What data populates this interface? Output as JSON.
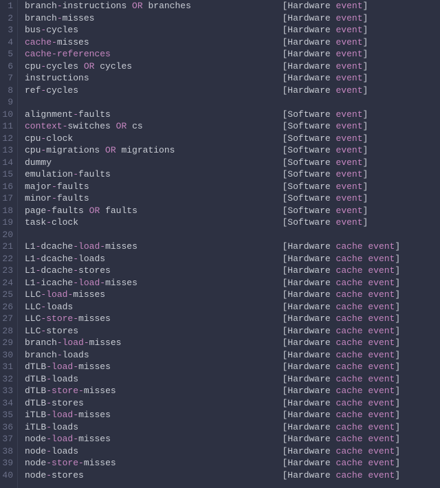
{
  "colors": {
    "background": "#2d3142",
    "foreground": "#c8ccd4",
    "gutter": "#6b7089",
    "gutterBorder": "#3a3f52",
    "keyword": "#c586c0",
    "highlight": "#c586c0"
  },
  "columnStart": 48,
  "lines": [
    {
      "num": 1,
      "left": [
        [
          "plain",
          "branch"
        ],
        [
          "kw",
          "-"
        ],
        [
          "plain",
          "instructions"
        ],
        [
          "kw",
          " OR "
        ],
        [
          "plain",
          "branches"
        ]
      ],
      "right": [
        [
          "plain",
          "[Hardware "
        ],
        [
          "hl",
          "event"
        ],
        [
          "plain",
          "]"
        ]
      ]
    },
    {
      "num": 2,
      "left": [
        [
          "plain",
          "branch"
        ],
        [
          "kw",
          "-"
        ],
        [
          "plain",
          "misses"
        ]
      ],
      "right": [
        [
          "plain",
          "[Hardware "
        ],
        [
          "hl",
          "event"
        ],
        [
          "plain",
          "]"
        ]
      ]
    },
    {
      "num": 3,
      "left": [
        [
          "plain",
          "bus"
        ],
        [
          "kw",
          "-"
        ],
        [
          "plain",
          "cycles"
        ]
      ],
      "right": [
        [
          "plain",
          "[Hardware "
        ],
        [
          "hl",
          "event"
        ],
        [
          "plain",
          "]"
        ]
      ]
    },
    {
      "num": 4,
      "left": [
        [
          "hl",
          "cache"
        ],
        [
          "kw",
          "-"
        ],
        [
          "plain",
          "misses"
        ]
      ],
      "right": [
        [
          "plain",
          "[Hardware "
        ],
        [
          "hl",
          "event"
        ],
        [
          "plain",
          "]"
        ]
      ]
    },
    {
      "num": 5,
      "left": [
        [
          "hl",
          "cache"
        ],
        [
          "kw",
          "-"
        ],
        [
          "hl",
          "references"
        ]
      ],
      "right": [
        [
          "plain",
          "[Hardware "
        ],
        [
          "hl",
          "event"
        ],
        [
          "plain",
          "]"
        ]
      ]
    },
    {
      "num": 6,
      "left": [
        [
          "plain",
          "cpu"
        ],
        [
          "kw",
          "-"
        ],
        [
          "plain",
          "cycles"
        ],
        [
          "kw",
          " OR "
        ],
        [
          "plain",
          "cycles"
        ]
      ],
      "right": [
        [
          "plain",
          "[Hardware "
        ],
        [
          "hl",
          "event"
        ],
        [
          "plain",
          "]"
        ]
      ]
    },
    {
      "num": 7,
      "left": [
        [
          "plain",
          "instructions"
        ]
      ],
      "right": [
        [
          "plain",
          "[Hardware "
        ],
        [
          "hl",
          "event"
        ],
        [
          "plain",
          "]"
        ]
      ]
    },
    {
      "num": 8,
      "left": [
        [
          "plain",
          "ref"
        ],
        [
          "kw",
          "-"
        ],
        [
          "plain",
          "cycles"
        ]
      ],
      "right": [
        [
          "plain",
          "[Hardware "
        ],
        [
          "hl",
          "event"
        ],
        [
          "plain",
          "]"
        ]
      ]
    },
    {
      "num": 9,
      "left": [],
      "right": []
    },
    {
      "num": 10,
      "left": [
        [
          "plain",
          "alignment"
        ],
        [
          "kw",
          "-"
        ],
        [
          "plain",
          "faults"
        ]
      ],
      "right": [
        [
          "plain",
          "[Software "
        ],
        [
          "hl",
          "event"
        ],
        [
          "plain",
          "]"
        ]
      ]
    },
    {
      "num": 11,
      "left": [
        [
          "hl",
          "context"
        ],
        [
          "kw",
          "-"
        ],
        [
          "plain",
          "switches"
        ],
        [
          "kw",
          " OR "
        ],
        [
          "plain",
          "cs"
        ]
      ],
      "right": [
        [
          "plain",
          "[Software "
        ],
        [
          "hl",
          "event"
        ],
        [
          "plain",
          "]"
        ]
      ]
    },
    {
      "num": 12,
      "left": [
        [
          "plain",
          "cpu"
        ],
        [
          "kw",
          "-"
        ],
        [
          "plain",
          "clock"
        ]
      ],
      "right": [
        [
          "plain",
          "[Software "
        ],
        [
          "hl",
          "event"
        ],
        [
          "plain",
          "]"
        ]
      ]
    },
    {
      "num": 13,
      "left": [
        [
          "plain",
          "cpu"
        ],
        [
          "kw",
          "-"
        ],
        [
          "plain",
          "migrations"
        ],
        [
          "kw",
          " OR "
        ],
        [
          "plain",
          "migrations"
        ]
      ],
      "right": [
        [
          "plain",
          "[Software "
        ],
        [
          "hl",
          "event"
        ],
        [
          "plain",
          "]"
        ]
      ]
    },
    {
      "num": 14,
      "left": [
        [
          "plain",
          "dummy"
        ]
      ],
      "right": [
        [
          "plain",
          "[Software "
        ],
        [
          "hl",
          "event"
        ],
        [
          "plain",
          "]"
        ]
      ]
    },
    {
      "num": 15,
      "left": [
        [
          "plain",
          "emulation"
        ],
        [
          "kw",
          "-"
        ],
        [
          "plain",
          "faults"
        ]
      ],
      "right": [
        [
          "plain",
          "[Software "
        ],
        [
          "hl",
          "event"
        ],
        [
          "plain",
          "]"
        ]
      ]
    },
    {
      "num": 16,
      "left": [
        [
          "plain",
          "major"
        ],
        [
          "kw",
          "-"
        ],
        [
          "plain",
          "faults"
        ]
      ],
      "right": [
        [
          "plain",
          "[Software "
        ],
        [
          "hl",
          "event"
        ],
        [
          "plain",
          "]"
        ]
      ]
    },
    {
      "num": 17,
      "left": [
        [
          "plain",
          "minor"
        ],
        [
          "kw",
          "-"
        ],
        [
          "plain",
          "faults"
        ]
      ],
      "right": [
        [
          "plain",
          "[Software "
        ],
        [
          "hl",
          "event"
        ],
        [
          "plain",
          "]"
        ]
      ]
    },
    {
      "num": 18,
      "left": [
        [
          "plain",
          "page"
        ],
        [
          "kw",
          "-"
        ],
        [
          "plain",
          "faults"
        ],
        [
          "kw",
          " OR "
        ],
        [
          "plain",
          "faults"
        ]
      ],
      "right": [
        [
          "plain",
          "[Software "
        ],
        [
          "hl",
          "event"
        ],
        [
          "plain",
          "]"
        ]
      ]
    },
    {
      "num": 19,
      "left": [
        [
          "plain",
          "task"
        ],
        [
          "kw",
          "-"
        ],
        [
          "plain",
          "clock"
        ]
      ],
      "right": [
        [
          "plain",
          "[Software "
        ],
        [
          "hl",
          "event"
        ],
        [
          "plain",
          "]"
        ]
      ]
    },
    {
      "num": 20,
      "left": [],
      "right": []
    },
    {
      "num": 21,
      "left": [
        [
          "plain",
          "L1"
        ],
        [
          "kw",
          "-"
        ],
        [
          "plain",
          "dcache"
        ],
        [
          "kw",
          "-"
        ],
        [
          "hl",
          "load"
        ],
        [
          "kw",
          "-"
        ],
        [
          "plain",
          "misses"
        ]
      ],
      "right": [
        [
          "plain",
          "[Hardware "
        ],
        [
          "hl",
          "cache event"
        ],
        [
          "plain",
          "]"
        ]
      ]
    },
    {
      "num": 22,
      "left": [
        [
          "plain",
          "L1"
        ],
        [
          "kw",
          "-"
        ],
        [
          "plain",
          "dcache"
        ],
        [
          "kw",
          "-"
        ],
        [
          "plain",
          "loads"
        ]
      ],
      "right": [
        [
          "plain",
          "[Hardware "
        ],
        [
          "hl",
          "cache event"
        ],
        [
          "plain",
          "]"
        ]
      ]
    },
    {
      "num": 23,
      "left": [
        [
          "plain",
          "L1"
        ],
        [
          "kw",
          "-"
        ],
        [
          "plain",
          "dcache"
        ],
        [
          "kw",
          "-"
        ],
        [
          "plain",
          "stores"
        ]
      ],
      "right": [
        [
          "plain",
          "[Hardware "
        ],
        [
          "hl",
          "cache event"
        ],
        [
          "plain",
          "]"
        ]
      ]
    },
    {
      "num": 24,
      "left": [
        [
          "plain",
          "L1"
        ],
        [
          "kw",
          "-"
        ],
        [
          "plain",
          "icache"
        ],
        [
          "kw",
          "-"
        ],
        [
          "hl",
          "load"
        ],
        [
          "kw",
          "-"
        ],
        [
          "plain",
          "misses"
        ]
      ],
      "right": [
        [
          "plain",
          "[Hardware "
        ],
        [
          "hl",
          "cache event"
        ],
        [
          "plain",
          "]"
        ]
      ]
    },
    {
      "num": 25,
      "left": [
        [
          "plain",
          "LLC"
        ],
        [
          "kw",
          "-"
        ],
        [
          "hl",
          "load"
        ],
        [
          "kw",
          "-"
        ],
        [
          "plain",
          "misses"
        ]
      ],
      "right": [
        [
          "plain",
          "[Hardware "
        ],
        [
          "hl",
          "cache event"
        ],
        [
          "plain",
          "]"
        ]
      ]
    },
    {
      "num": 26,
      "left": [
        [
          "plain",
          "LLC"
        ],
        [
          "kw",
          "-"
        ],
        [
          "plain",
          "loads"
        ]
      ],
      "right": [
        [
          "plain",
          "[Hardware "
        ],
        [
          "hl",
          "cache event"
        ],
        [
          "plain",
          "]"
        ]
      ]
    },
    {
      "num": 27,
      "left": [
        [
          "plain",
          "LLC"
        ],
        [
          "kw",
          "-"
        ],
        [
          "hl",
          "store"
        ],
        [
          "kw",
          "-"
        ],
        [
          "plain",
          "misses"
        ]
      ],
      "right": [
        [
          "plain",
          "[Hardware "
        ],
        [
          "hl",
          "cache event"
        ],
        [
          "plain",
          "]"
        ]
      ]
    },
    {
      "num": 28,
      "left": [
        [
          "plain",
          "LLC"
        ],
        [
          "kw",
          "-"
        ],
        [
          "plain",
          "stores"
        ]
      ],
      "right": [
        [
          "plain",
          "[Hardware "
        ],
        [
          "hl",
          "cache event"
        ],
        [
          "plain",
          "]"
        ]
      ]
    },
    {
      "num": 29,
      "left": [
        [
          "plain",
          "branch"
        ],
        [
          "kw",
          "-"
        ],
        [
          "hl",
          "load"
        ],
        [
          "kw",
          "-"
        ],
        [
          "plain",
          "misses"
        ]
      ],
      "right": [
        [
          "plain",
          "[Hardware "
        ],
        [
          "hl",
          "cache event"
        ],
        [
          "plain",
          "]"
        ]
      ]
    },
    {
      "num": 30,
      "left": [
        [
          "plain",
          "branch"
        ],
        [
          "kw",
          "-"
        ],
        [
          "plain",
          "loads"
        ]
      ],
      "right": [
        [
          "plain",
          "[Hardware "
        ],
        [
          "hl",
          "cache event"
        ],
        [
          "plain",
          "]"
        ]
      ]
    },
    {
      "num": 31,
      "left": [
        [
          "plain",
          "dTLB"
        ],
        [
          "kw",
          "-"
        ],
        [
          "hl",
          "load"
        ],
        [
          "kw",
          "-"
        ],
        [
          "plain",
          "misses"
        ]
      ],
      "right": [
        [
          "plain",
          "[Hardware "
        ],
        [
          "hl",
          "cache event"
        ],
        [
          "plain",
          "]"
        ]
      ]
    },
    {
      "num": 32,
      "left": [
        [
          "plain",
          "dTLB"
        ],
        [
          "kw",
          "-"
        ],
        [
          "plain",
          "loads"
        ]
      ],
      "right": [
        [
          "plain",
          "[Hardware "
        ],
        [
          "hl",
          "cache event"
        ],
        [
          "plain",
          "]"
        ]
      ]
    },
    {
      "num": 33,
      "left": [
        [
          "plain",
          "dTLB"
        ],
        [
          "kw",
          "-"
        ],
        [
          "hl",
          "store"
        ],
        [
          "kw",
          "-"
        ],
        [
          "plain",
          "misses"
        ]
      ],
      "right": [
        [
          "plain",
          "[Hardware "
        ],
        [
          "hl",
          "cache event"
        ],
        [
          "plain",
          "]"
        ]
      ]
    },
    {
      "num": 34,
      "left": [
        [
          "plain",
          "dTLB"
        ],
        [
          "kw",
          "-"
        ],
        [
          "plain",
          "stores"
        ]
      ],
      "right": [
        [
          "plain",
          "[Hardware "
        ],
        [
          "hl",
          "cache event"
        ],
        [
          "plain",
          "]"
        ]
      ]
    },
    {
      "num": 35,
      "left": [
        [
          "plain",
          "iTLB"
        ],
        [
          "kw",
          "-"
        ],
        [
          "hl",
          "load"
        ],
        [
          "kw",
          "-"
        ],
        [
          "plain",
          "misses"
        ]
      ],
      "right": [
        [
          "plain",
          "[Hardware "
        ],
        [
          "hl",
          "cache event"
        ],
        [
          "plain",
          "]"
        ]
      ]
    },
    {
      "num": 36,
      "left": [
        [
          "plain",
          "iTLB"
        ],
        [
          "kw",
          "-"
        ],
        [
          "plain",
          "loads"
        ]
      ],
      "right": [
        [
          "plain",
          "[Hardware "
        ],
        [
          "hl",
          "cache event"
        ],
        [
          "plain",
          "]"
        ]
      ]
    },
    {
      "num": 37,
      "left": [
        [
          "plain",
          "node"
        ],
        [
          "kw",
          "-"
        ],
        [
          "hl",
          "load"
        ],
        [
          "kw",
          "-"
        ],
        [
          "plain",
          "misses"
        ]
      ],
      "right": [
        [
          "plain",
          "[Hardware "
        ],
        [
          "hl",
          "cache event"
        ],
        [
          "plain",
          "]"
        ]
      ]
    },
    {
      "num": 38,
      "left": [
        [
          "plain",
          "node"
        ],
        [
          "kw",
          "-"
        ],
        [
          "plain",
          "loads"
        ]
      ],
      "right": [
        [
          "plain",
          "[Hardware "
        ],
        [
          "hl",
          "cache event"
        ],
        [
          "plain",
          "]"
        ]
      ]
    },
    {
      "num": 39,
      "left": [
        [
          "plain",
          "node"
        ],
        [
          "kw",
          "-"
        ],
        [
          "hl",
          "store"
        ],
        [
          "kw",
          "-"
        ],
        [
          "plain",
          "misses"
        ]
      ],
      "right": [
        [
          "plain",
          "[Hardware "
        ],
        [
          "hl",
          "cache event"
        ],
        [
          "plain",
          "]"
        ]
      ]
    },
    {
      "num": 40,
      "left": [
        [
          "plain",
          "node"
        ],
        [
          "kw",
          "-"
        ],
        [
          "plain",
          "stores"
        ]
      ],
      "right": [
        [
          "plain",
          "[Hardware "
        ],
        [
          "hl",
          "cache event"
        ],
        [
          "plain",
          "]"
        ]
      ]
    }
  ]
}
